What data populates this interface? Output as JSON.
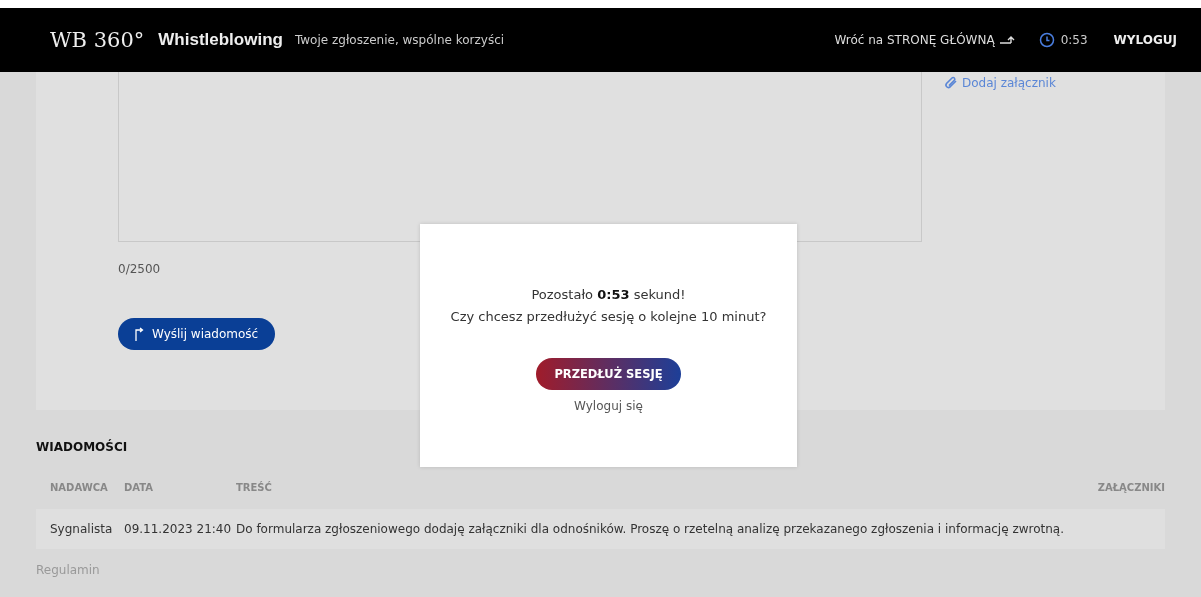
{
  "header": {
    "logo": "WB 360°",
    "brand": "Whistleblowing",
    "tagline": "Twoje zgłoszenie, wspólne korzyści",
    "home_link": "Wróć na STRONĘ GŁÓWNĄ",
    "timer": "0:53",
    "logout": "WYLOGUJ"
  },
  "form": {
    "attach_link": "Dodaj załącznik",
    "char_count": "0/2500",
    "send_button": "Wyślij wiadomość"
  },
  "messages": {
    "title": "WIADOMOŚCI",
    "columns": [
      "NADAWCA",
      "DATA",
      "TREŚĆ",
      "ZAŁĄCZNIKI"
    ],
    "rows": [
      {
        "cells": [
          "Sygnalista",
          "09.11.2023 21:40",
          "Do formularza zgłoszeniowego dodaję załączniki dla odnośników. Proszę o rzetelną analizę przekazanego zgłoszenia i informację zwrotną."
        ]
      }
    ]
  },
  "footer": {
    "link": "Regulamin"
  },
  "modal": {
    "message": "Pozostało **0:53** sekund!",
    "question": "Czy chcesz przedłużyć sesję o kolejne 10 minut?",
    "extend_button": "PRZEDŁUŻ SESJĘ",
    "logout_link": "Wyloguj się"
  }
}
